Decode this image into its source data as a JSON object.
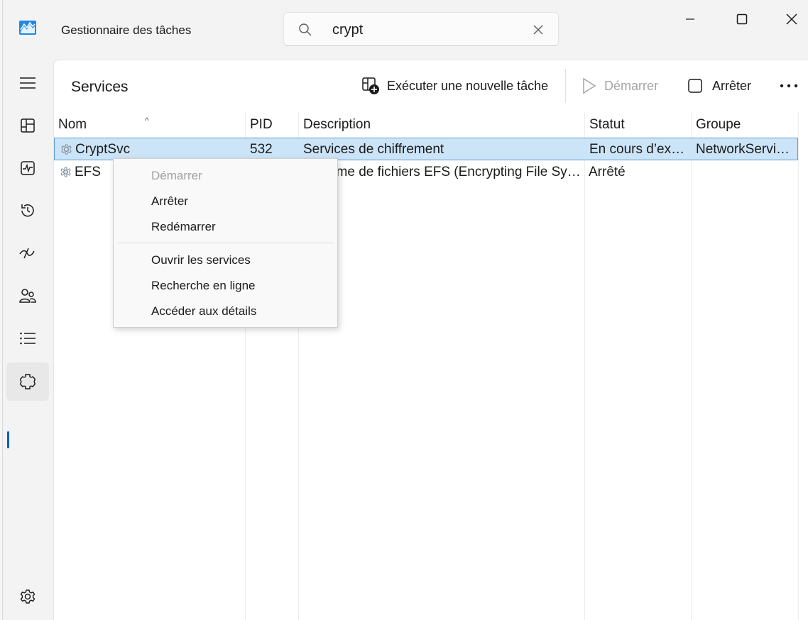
{
  "app": {
    "title": "Gestionnaire des tâches"
  },
  "search": {
    "value": "crypt",
    "placeholder": ""
  },
  "nav": {
    "items": [
      {
        "icon": "hamburger-menu-icon"
      },
      {
        "icon": "processes-icon"
      },
      {
        "icon": "performance-icon"
      },
      {
        "icon": "app-history-icon"
      },
      {
        "icon": "startup-apps-icon"
      },
      {
        "icon": "users-icon"
      },
      {
        "icon": "details-icon"
      },
      {
        "icon": "services-icon",
        "active": true
      },
      {
        "icon": "settings-icon"
      }
    ]
  },
  "page": {
    "title": "Services"
  },
  "toolbar": {
    "run_task_label": "Exécuter une nouvelle tâche",
    "start_label": "Démarrer",
    "stop_label": "Arrêter"
  },
  "table": {
    "columns": [
      "Nom",
      "PID",
      "Description",
      "Statut",
      "Groupe"
    ],
    "rows": [
      {
        "name": "CryptSvc",
        "pid": "532",
        "description": "Services de chiffrement",
        "status": "En cours d’exé…",
        "group": "NetworkServi…",
        "selected": true
      },
      {
        "name": "EFS",
        "pid": "",
        "description": "Système de fichiers EFS (Encrypting File Sys…",
        "status": "Arrêté",
        "group": ""
      }
    ]
  },
  "context_menu": {
    "items": [
      {
        "label": "Démarrer",
        "disabled": true
      },
      {
        "label": "Arrêter"
      },
      {
        "label": "Redémarrer"
      },
      {
        "label": "Ouvrir les services"
      },
      {
        "label": "Recherche en ligne"
      },
      {
        "label": "Accéder aux détails"
      }
    ]
  },
  "colors": {
    "accent": "#005fb8",
    "selection": "#cce4f7",
    "selection_border": "#5b9bd5"
  }
}
